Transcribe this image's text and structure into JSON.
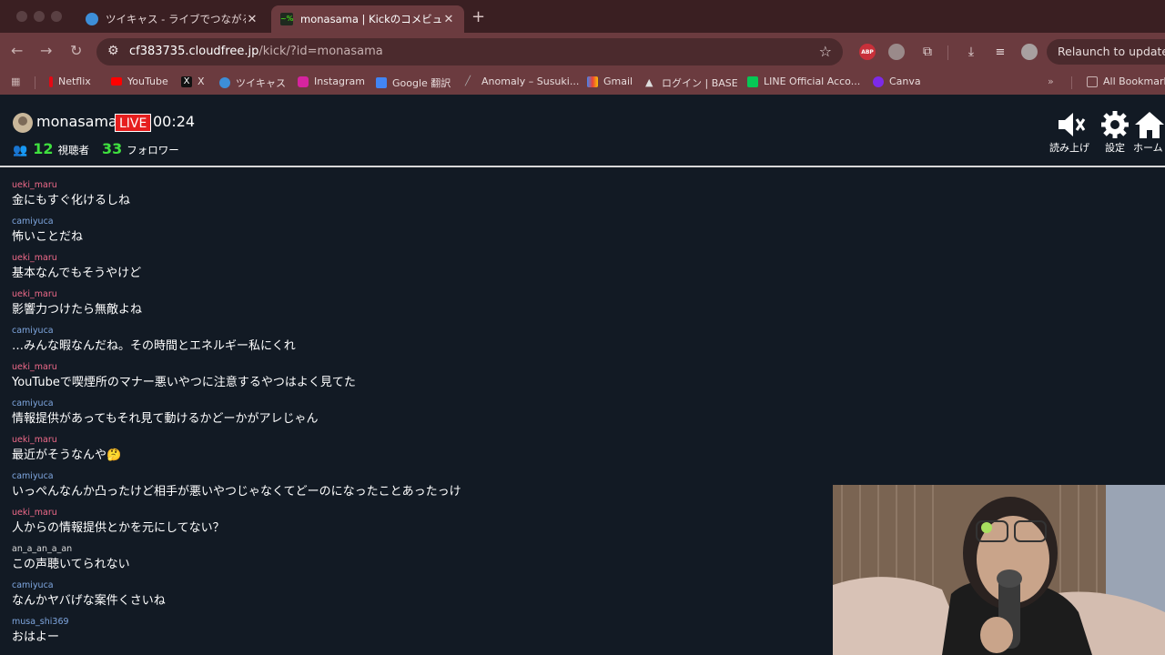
{
  "browser": {
    "tabs": [
      {
        "title": "ツイキャス - ライブでつながるコ",
        "active": false
      },
      {
        "title": "monasama | Kickのコメビュ",
        "active": true
      }
    ],
    "url_host": "cf383735.cloudfree.jp",
    "url_path": "/kick/?id=monasama",
    "relaunch_label": "Relaunch to update",
    "abp_label": "ABP",
    "bookmarks": [
      {
        "label": "Netflix",
        "color": "#e50914"
      },
      {
        "label": "YouTube",
        "color": "#ff0000"
      },
      {
        "label": "X",
        "color": "#000000"
      },
      {
        "label": "ツイキャス",
        "color": "#3d8ed8"
      },
      {
        "label": "Instagram",
        "color": "#d6249f"
      },
      {
        "label": "Google 翻訳",
        "color": "#4285f4"
      },
      {
        "label": "Anomaly – Susuki...",
        "color": "#888888"
      },
      {
        "label": "Gmail",
        "color": "#ea4335"
      },
      {
        "label": "ログイン | BASE",
        "color": "#dddddd"
      },
      {
        "label": "LINE Official Acco...",
        "color": "#06c755"
      },
      {
        "label": "Canva",
        "color": "#7d2ae8"
      }
    ],
    "all_bookmarks_label": "All Bookmarks"
  },
  "header": {
    "channel_name": "monasama",
    "live_badge": "LIVE",
    "elapsed": "00:24",
    "viewers_count": "12",
    "viewers_label": "視聴者",
    "followers_count": "33",
    "followers_label": "フォロワー",
    "buttons": {
      "read_aloud": "読み上げ",
      "settings": "設定",
      "home": "ホーム"
    }
  },
  "chat": [
    {
      "user": "ueki_maru",
      "text": "金にもすぐ化けるしね",
      "color": "#f06a8a"
    },
    {
      "user": "camiyuca",
      "text": "怖いことだね",
      "color": "#7fa7e0"
    },
    {
      "user": "ueki_maru",
      "text": "基本なんでもそうやけど",
      "color": "#f06a8a"
    },
    {
      "user": "ueki_maru",
      "text": "影響力つけたら無敵よね",
      "color": "#f06a8a"
    },
    {
      "user": "camiyuca",
      "text": "…みんな暇なんだね。その時間とエネルギー私にくれ",
      "color": "#7fa7e0"
    },
    {
      "user": "ueki_maru",
      "text": "YouTubeで喫煙所のマナー悪いやつに注意するやつはよく見てた",
      "color": "#f06a8a"
    },
    {
      "user": "camiyuca",
      "text": "情報提供があってもそれ見て動けるかどーかがアレじゃん",
      "color": "#7fa7e0"
    },
    {
      "user": "ueki_maru",
      "text": "最近がそうなんや🤔",
      "color": "#f06a8a"
    },
    {
      "user": "camiyuca",
      "text": "いっぺんなんか凸ったけど相手が悪いやつじゃなくてどーのになったことあったっけ",
      "color": "#7fa7e0"
    },
    {
      "user": "ueki_maru",
      "text": "人からの情報提供とかを元にしてない？",
      "color": "#f06a8a"
    },
    {
      "user": "an_a_an_a_an",
      "text": "この声聴いてられない",
      "color": "#dcdcdc"
    },
    {
      "user": "camiyuca",
      "text": "なんかヤバげな案件くさいね",
      "color": "#7fa7e0"
    },
    {
      "user": "musa_shi369",
      "text": "おはよー",
      "color": "#7fa7e0"
    }
  ]
}
